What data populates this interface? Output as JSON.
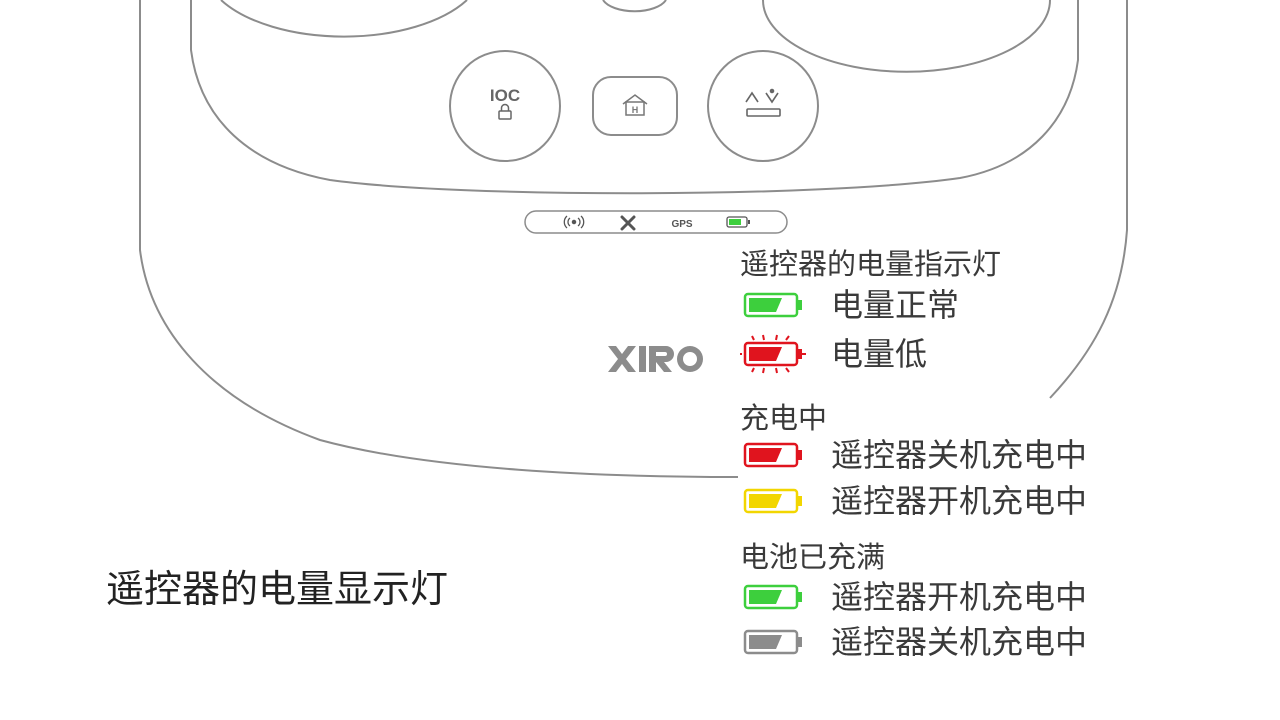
{
  "controller": {
    "buttons": {
      "ioc_label": "IOC"
    },
    "status_bar": {
      "gps_label": "GPS"
    },
    "brand_logo": "XIRO"
  },
  "page_title": "遥控器的电量显示灯",
  "legend": {
    "sections": [
      {
        "title": "遥控器的电量指示灯",
        "items": [
          {
            "label": "电量正常",
            "battery_color": "#3dcf3d",
            "state": "normal"
          },
          {
            "label": "电量低",
            "battery_color": "#e0141e",
            "state": "blinking"
          }
        ]
      },
      {
        "title": "充电中",
        "items": [
          {
            "label": "遥控器关机充电中",
            "battery_color": "#e0141e",
            "state": "charging"
          },
          {
            "label": "遥控器开机充电中",
            "battery_color": "#f2d600",
            "state": "charging"
          }
        ]
      },
      {
        "title": "电池已充满",
        "items": [
          {
            "label": "遥控器开机充电中",
            "battery_color": "#3dcf3d",
            "state": "full"
          },
          {
            "label": "遥控器关机充电中",
            "battery_color": "#8c8c8c",
            "state": "full"
          }
        ]
      }
    ]
  },
  "colors": {
    "outline": "#8c8c8c",
    "battery_green": "#3dcf3d",
    "battery_red": "#e0141e",
    "battery_yellow": "#f2d600",
    "battery_gray": "#8c8c8c",
    "text": "#3a3a3a"
  }
}
